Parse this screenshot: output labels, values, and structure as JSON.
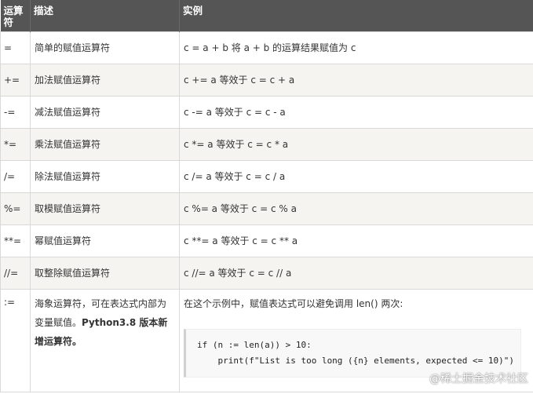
{
  "table": {
    "headers": [
      "运算符",
      "描述",
      "实例"
    ],
    "rows": [
      {
        "op": "=",
        "desc": "简单的赋值运算符",
        "example": "c = a + b 将 a + b 的运算结果赋值为 c"
      },
      {
        "op": "+=",
        "desc": "加法赋值运算符",
        "example": "c += a 等效于 c = c + a"
      },
      {
        "op": "-=",
        "desc": "减法赋值运算符",
        "example": "c -= a 等效于 c = c - a"
      },
      {
        "op": "*=",
        "desc": "乘法赋值运算符",
        "example": "c *= a 等效于 c = c * a"
      },
      {
        "op": "/=",
        "desc": "除法赋值运算符",
        "example": "c /= a 等效于 c = c / a"
      },
      {
        "op": "%=",
        "desc": "取模赋值运算符",
        "example": "c %= a 等效于 c = c % a"
      },
      {
        "op": "**=",
        "desc": "幂赋值运算符",
        "example": "c **= a 等效于 c = c ** a"
      },
      {
        "op": "//=",
        "desc": "取整除赋值运算符",
        "example": "c //= a 等效于 c = c // a"
      }
    ],
    "last_row": {
      "op": ":=",
      "desc_plain": "海象运算符，可在表达式内部为变量赋值。",
      "desc_bold": "Python3.8 版本新增运算符。",
      "example_text": "在这个示例中，赋值表达式可以避免调用 len() 两次:",
      "code_line1": "if (n := len(a)) > 10:",
      "code_line2": "    print(f\"List is too long ({n} elements, expected <= 10)\")"
    }
  },
  "watermark": "@稀土掘金技术社区"
}
